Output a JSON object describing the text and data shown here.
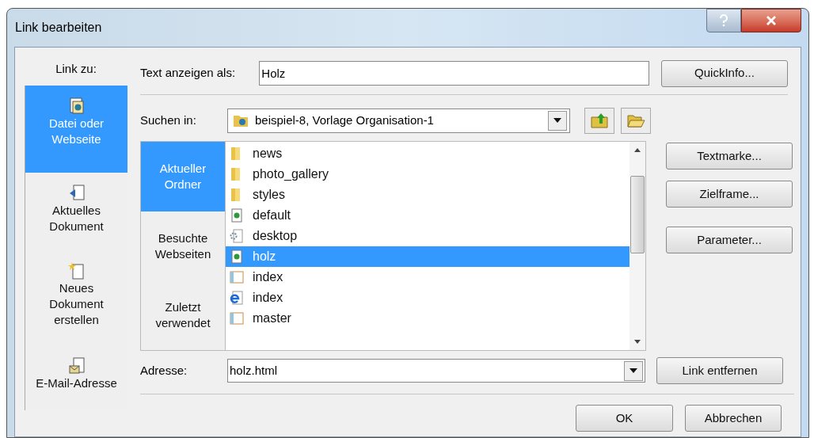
{
  "window": {
    "title": "Link bearbeiten"
  },
  "link_to": {
    "label": "Link zu:",
    "items": [
      {
        "label": "Datei oder Webseite",
        "kind": "file",
        "selected": true
      },
      {
        "label": "Aktuelles Dokument",
        "kind": "document",
        "selected": false
      },
      {
        "label": "Neues Dokument erstellen",
        "kind": "new",
        "selected": false
      },
      {
        "label": "E-Mail-Adresse",
        "kind": "email",
        "selected": false
      }
    ]
  },
  "display_text": {
    "label": "Text anzeigen als:",
    "value": "Holz"
  },
  "quickinfo_button": "QuickInfo...",
  "look_in": {
    "label": "Suchen in:",
    "value": "beispiel-8, Vorlage Organisation-1"
  },
  "browse_tabs": [
    {
      "label": "Aktueller Ordner",
      "selected": true
    },
    {
      "label": "Besuchte Webseiten",
      "selected": false
    },
    {
      "label": "Zuletzt verwendet",
      "selected": false
    }
  ],
  "files": [
    {
      "name": "news",
      "kind": "folder",
      "selected": false
    },
    {
      "name": "photo_gallery",
      "kind": "folder",
      "selected": false
    },
    {
      "name": "styles",
      "kind": "folder",
      "selected": false
    },
    {
      "name": "default",
      "kind": "page",
      "selected": false
    },
    {
      "name": "desktop",
      "kind": "config",
      "selected": false
    },
    {
      "name": "holz",
      "kind": "page",
      "selected": true
    },
    {
      "name": "index",
      "kind": "frame",
      "selected": false
    },
    {
      "name": "index",
      "kind": "web",
      "selected": false
    },
    {
      "name": "master",
      "kind": "frame",
      "selected": false
    }
  ],
  "side_buttons": [
    "Textmarke...",
    "Zielframe...",
    "Parameter..."
  ],
  "address": {
    "label": "Adresse:",
    "value": "holz.html"
  },
  "remove_link_button": "Link entfernen",
  "dialog_buttons": [
    "OK",
    "Abbrechen"
  ]
}
